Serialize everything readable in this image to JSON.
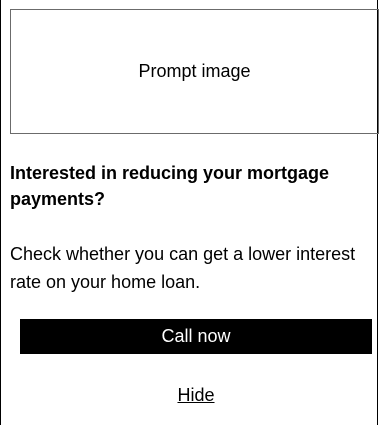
{
  "prompt_image": {
    "label": "Prompt image"
  },
  "headline": "Interested in reducing your mortgage payments?",
  "body": "Check whether you can get a lower interest rate on your home loan.",
  "cta": {
    "label": "Call now"
  },
  "dismiss": {
    "label": "Hide"
  }
}
